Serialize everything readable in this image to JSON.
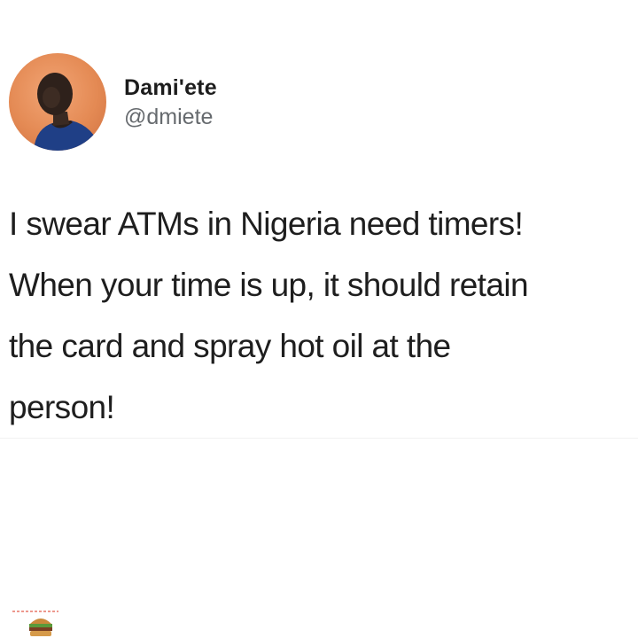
{
  "tweet": {
    "author": {
      "display_name": "Dami'ete",
      "handle": "@dmiete",
      "avatar_icon": "profile-photo"
    },
    "text": "I swear ATMs in Nigeria need timers!\nWhen your time is up, it should retain\nthe card and spray hot oil at the\nperson!",
    "footer_icon": "sandwich-emoji-icon"
  },
  "colors": {
    "background": "#ffffff",
    "text": "#1e1e1e",
    "handle": "#666a6e",
    "avatar_bg": "#e48a54"
  }
}
